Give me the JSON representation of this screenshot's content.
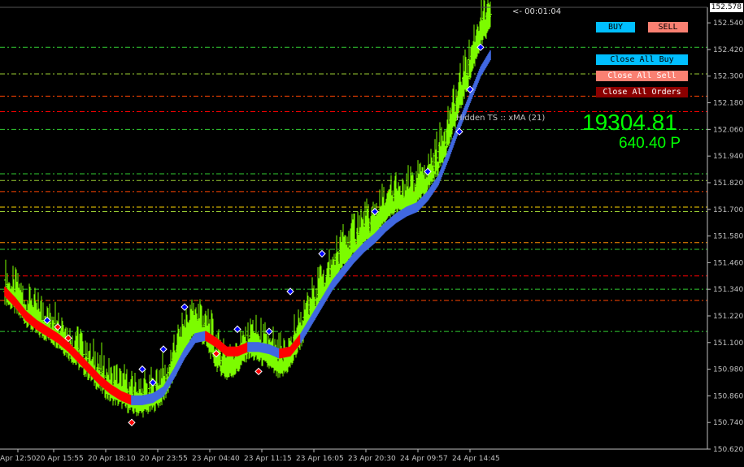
{
  "colors": {
    "background": "#000000",
    "axis": "#c0c0c0",
    "candle_up": "#7cfc00",
    "trend_up": "#4169e1",
    "trend_down": "#ff0000",
    "buy_button": "#00bfff",
    "sell_button": "#fa8072",
    "close_orders_button": "#8b0000",
    "profit_text": "#00ff00"
  },
  "timer": "<- 00:01:04",
  "indicator_label": "Hidden TS :: xMA (21)",
  "profit": {
    "amount": "19304.81",
    "points": "640.40 P"
  },
  "buttons": {
    "buy": "BUY",
    "sell": "SELL",
    "close_all_buy": "Close All Buy",
    "close_all_sell": "Close All Sell",
    "close_all_orders": "Close All Orders"
  },
  "current_price": "152.578",
  "chart_data": {
    "type": "candlestick",
    "price_scale": [
      "152.540",
      "152.420",
      "152.300",
      "152.180",
      "152.060",
      "151.940",
      "151.820",
      "151.700",
      "151.580",
      "151.460",
      "151.340",
      "151.220",
      "151.100",
      "150.980",
      "150.860",
      "150.740",
      "150.620"
    ],
    "ylim": [
      150.62,
      152.61
    ],
    "time_labels": [
      "Apr 12:50",
      "20 Apr 15:55",
      "20 Apr 18:10",
      "20 Apr 23:55",
      "23 Apr 04:40",
      "23 Apr 11:15",
      "23 Apr 16:05",
      "23 Apr 20:30",
      "24 Apr 09:57",
      "24 Apr 14:45"
    ],
    "close_series": [
      151.35,
      151.3,
      151.25,
      151.2,
      151.18,
      151.15,
      151.1,
      151.05,
      151.0,
      150.95,
      150.9,
      150.88,
      150.85,
      150.84,
      150.86,
      150.9,
      151.0,
      151.12,
      151.2,
      151.15,
      151.05,
      151.0,
      151.03,
      151.1,
      151.08,
      151.05,
      151.0,
      151.05,
      151.15,
      151.25,
      151.35,
      151.42,
      151.5,
      151.55,
      151.6,
      151.63,
      151.7,
      151.75,
      151.74,
      151.78,
      151.85,
      151.93,
      152.05,
      152.2,
      152.35,
      152.5,
      152.57
    ],
    "trend_series": [
      151.33,
      151.28,
      151.22,
      151.18,
      151.15,
      151.12,
      151.08,
      151.03,
      150.98,
      150.93,
      150.89,
      150.86,
      150.84,
      150.84,
      150.85,
      150.88,
      150.96,
      151.05,
      151.12,
      151.13,
      151.1,
      151.06,
      151.06,
      151.08,
      151.08,
      151.07,
      151.05,
      151.06,
      151.12,
      151.2,
      151.28,
      151.36,
      151.42,
      151.48,
      151.53,
      151.57,
      151.62,
      151.66,
      151.69,
      151.71,
      151.76,
      151.83,
      151.95,
      152.08,
      152.2,
      152.32,
      152.4
    ],
    "trend_state": [
      "down",
      "down",
      "down",
      "down",
      "down",
      "down",
      "down",
      "down",
      "down",
      "down",
      "down",
      "down",
      "up",
      "up",
      "up",
      "up",
      "up",
      "up",
      "up",
      "down",
      "down",
      "down",
      "down",
      "up",
      "up",
      "up",
      "down",
      "down",
      "up",
      "up",
      "up",
      "up",
      "up",
      "up",
      "up",
      "up",
      "up",
      "up",
      "up",
      "up",
      "up",
      "up",
      "up",
      "up",
      "up",
      "up",
      "up"
    ],
    "levels": [
      {
        "price": 152.43,
        "color": "#32cd32"
      },
      {
        "price": 152.31,
        "color": "#9acd32"
      },
      {
        "price": 152.21,
        "color": "#ff4500"
      },
      {
        "price": 152.14,
        "color": "#ff0000"
      },
      {
        "price": 152.06,
        "color": "#32cd32"
      },
      {
        "price": 151.86,
        "color": "#32cd32"
      },
      {
        "price": 151.83,
        "color": "#9acd32"
      },
      {
        "price": 151.78,
        "color": "#ff4500"
      },
      {
        "price": 151.71,
        "color": "#ffd700"
      },
      {
        "price": 151.69,
        "color": "#9acd32"
      },
      {
        "price": 151.55,
        "color": "#ff8c00"
      },
      {
        "price": 151.52,
        "color": "#32cd32"
      },
      {
        "price": 151.4,
        "color": "#ff0000"
      },
      {
        "price": 151.34,
        "color": "#32cd32"
      },
      {
        "price": 151.29,
        "color": "#ff4500"
      },
      {
        "price": 151.15,
        "color": "#32cd32"
      }
    ],
    "markers": [
      {
        "t": 4,
        "price": 151.2,
        "kind": "buy"
      },
      {
        "t": 5,
        "price": 151.17,
        "kind": "sell"
      },
      {
        "t": 6,
        "price": 151.12,
        "kind": "sell"
      },
      {
        "t": 12,
        "price": 150.74,
        "kind": "sell"
      },
      {
        "t": 13,
        "price": 150.98,
        "kind": "buy"
      },
      {
        "t": 14,
        "price": 150.92,
        "kind": "buy"
      },
      {
        "t": 15,
        "price": 151.07,
        "kind": "buy"
      },
      {
        "t": 17,
        "price": 151.26,
        "kind": "buy"
      },
      {
        "t": 20,
        "price": 151.05,
        "kind": "sell"
      },
      {
        "t": 22,
        "price": 151.16,
        "kind": "buy"
      },
      {
        "t": 24,
        "price": 150.97,
        "kind": "sell"
      },
      {
        "t": 25,
        "price": 151.15,
        "kind": "buy"
      },
      {
        "t": 27,
        "price": 151.33,
        "kind": "buy"
      },
      {
        "t": 30,
        "price": 151.5,
        "kind": "buy"
      },
      {
        "t": 35,
        "price": 151.69,
        "kind": "buy"
      },
      {
        "t": 40,
        "price": 151.87,
        "kind": "buy"
      },
      {
        "t": 43,
        "price": 152.05,
        "kind": "buy"
      },
      {
        "t": 44,
        "price": 152.24,
        "kind": "buy"
      },
      {
        "t": 45,
        "price": 152.43,
        "kind": "buy"
      }
    ]
  }
}
